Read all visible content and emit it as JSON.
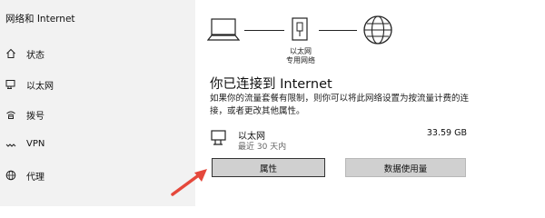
{
  "sidebar": {
    "title": "网络和 Internet",
    "items": [
      {
        "label": "状态",
        "icon": "home-icon"
      },
      {
        "label": "以太网",
        "icon": "ethernet-icon"
      },
      {
        "label": "拨号",
        "icon": "dialup-icon"
      },
      {
        "label": "VPN",
        "icon": "vpn-icon"
      },
      {
        "label": "代理",
        "icon": "globe-icon"
      }
    ]
  },
  "diagram": {
    "router_label_1": "以太网",
    "router_label_2": "专用网络"
  },
  "main": {
    "title": "你已连接到 Internet",
    "description": "如果你的流量套餐有限制，则你可以将此网络设置为按流量计费的连接，或者更改其他属性。"
  },
  "connection": {
    "name": "以太网",
    "subtitle": "最近 30 天内",
    "usage": "33.59 GB"
  },
  "buttons": {
    "properties": "属性",
    "data_usage": "数据使用量"
  },
  "colors": {
    "sidebar_bg": "#f2f2f2",
    "button_bg": "#d0d0d0",
    "arrow": "#e5483b"
  }
}
